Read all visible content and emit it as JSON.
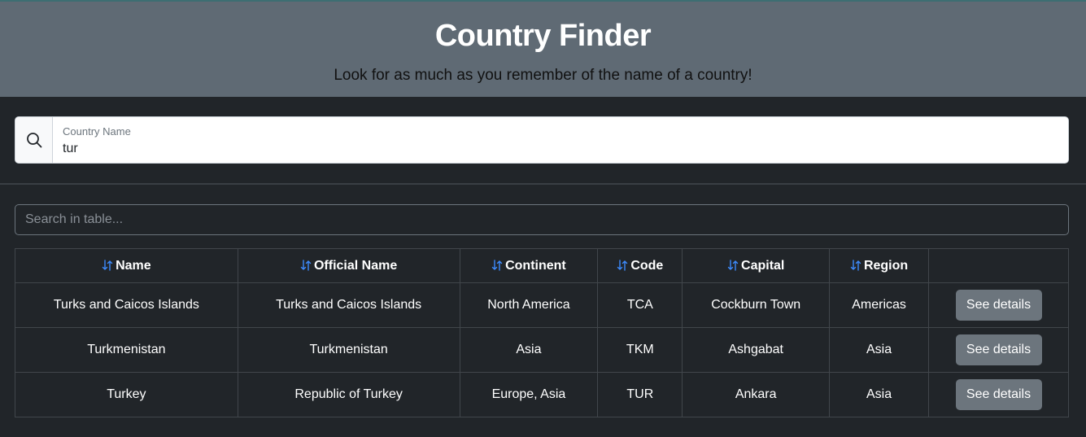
{
  "header": {
    "title": "Country Finder",
    "subtitle": "Look for as much as you remember of the name of a country!"
  },
  "search": {
    "label": "Country Name",
    "value": "tur",
    "icon": "search-icon"
  },
  "table_filter": {
    "placeholder": "Search in table..."
  },
  "table": {
    "columns": [
      "Name",
      "Official Name",
      "Continent",
      "Code",
      "Capital",
      "Region",
      ""
    ],
    "sort_icon_color": "#3d8bfd",
    "rows": [
      {
        "name": "Turks and Caicos Islands",
        "official": "Turks and Caicos Islands",
        "continent": "North America",
        "code": "TCA",
        "capital": "Cockburn Town",
        "region": "Americas",
        "action": "See details"
      },
      {
        "name": "Turkmenistan",
        "official": "Turkmenistan",
        "continent": "Asia",
        "code": "TKM",
        "capital": "Ashgabat",
        "region": "Asia",
        "action": "See details"
      },
      {
        "name": "Turkey",
        "official": "Republic of Turkey",
        "continent": "Europe, Asia",
        "code": "TUR",
        "capital": "Ankara",
        "region": "Asia",
        "action": "See details"
      }
    ]
  },
  "colors": {
    "header_bg": "#5f6a74",
    "page_bg": "#212529",
    "button_bg": "#6c757d"
  }
}
